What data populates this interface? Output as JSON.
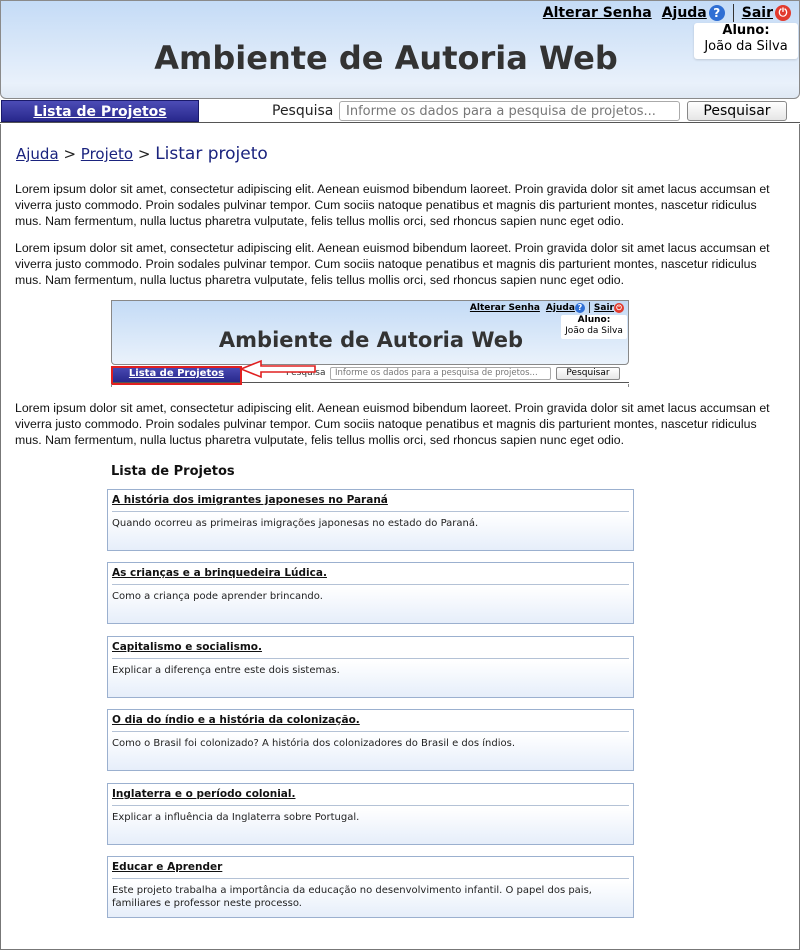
{
  "header": {
    "title": "Ambiente de Autoria Web",
    "links": {
      "change_password": "Alterar Senha",
      "help": "Ajuda",
      "logout": "Sair"
    },
    "student": {
      "label": "Aluno:",
      "name": "João da Silva"
    }
  },
  "nav": {
    "tab": "Lista de Projetos",
    "search_label": "Pesquisa",
    "search_placeholder": "Informe os dados para a pesquisa de projetos...",
    "search_button": "Pesquisar"
  },
  "breadcrumb": {
    "help": "Ajuda",
    "project": "Projeto",
    "separator": ">",
    "current": "Listar projeto"
  },
  "paragraphs": [
    "Lorem ipsum dolor sit amet, consectetur adipiscing elit. Aenean euismod bibendum laoreet. Proin gravida dolor sit amet lacus accumsan et viverra justo commodo. Proin sodales pulvinar tempor. Cum sociis natoque penatibus et magnis dis parturient montes, nascetur ridiculus mus. Nam fermentum, nulla luctus pharetra vulputate, felis tellus mollis orci, sed rhoncus sapien nunc eget odio.",
    "Lorem ipsum dolor sit amet, consectetur adipiscing elit. Aenean euismod bibendum laoreet. Proin gravida dolor sit amet lacus accumsan et viverra justo commodo. Proin sodales pulvinar tempor. Cum sociis natoque penatibus et magnis dis parturient montes, nascetur ridiculus mus. Nam fermentum, nulla luctus pharetra vulputate, felis tellus mollis orci, sed rhoncus sapien nunc eget odio.",
    "Lorem ipsum dolor sit amet, consectetur adipiscing elit. Aenean euismod bibendum laoreet. Proin gravida dolor sit amet lacus accumsan et viverra justo commodo. Proin sodales pulvinar tempor. Cum sociis natoque penatibus et magnis dis parturient montes, nascetur ridiculus mus. Nam fermentum, nulla luctus pharetra vulputate, felis tellus mollis orci, sed rhoncus sapien nunc eget odio."
  ],
  "preview": {
    "title": "Ambiente de Autoria Web",
    "change_password": "Alterar Senha",
    "help": "Ajuda",
    "logout": "Sair",
    "student_label": "Aluno:",
    "student_name": "João da Silva",
    "tab": "Lista de Projetos",
    "search_label": "Pesquisa",
    "search_placeholder": "Informe os dados para a pesquisa de projetos...",
    "search_button": "Pesquisar"
  },
  "projects_title": "Lista de Projetos",
  "projects": [
    {
      "title": "A história dos imigrantes japoneses no Paraná",
      "description": "Quando ocorreu as primeiras imigrações japonesas no estado do Paraná."
    },
    {
      "title": "As crianças e a brinquedeira Lúdica.",
      "description": "Como a criança pode aprender brincando."
    },
    {
      "title": "Capitalismo e socialismo.",
      "description": "Explicar a diferença entre este dois sistemas."
    },
    {
      "title": "O dia do índio e a história da colonização.",
      "description": "Como o Brasil foi colonizado? A história dos colonizadores do Brasil e dos índios."
    },
    {
      "title": "Inglaterra e o período colonial.",
      "description": "Explicar a influência da Inglaterra sobre Portugal."
    },
    {
      "title": "Educar e Aprender",
      "description": "Este projeto trabalha a importância da educação no desenvolvimento infantil. O papel dos pais, familiares e professor neste processo."
    }
  ],
  "colors": {
    "nav_tab": "#28288c",
    "header_top": "#c4dbf6",
    "highlight": "#e02020",
    "breadcrumb": "#1a237e"
  },
  "icons": {
    "help": "question-circle-icon",
    "logout": "power-icon"
  }
}
